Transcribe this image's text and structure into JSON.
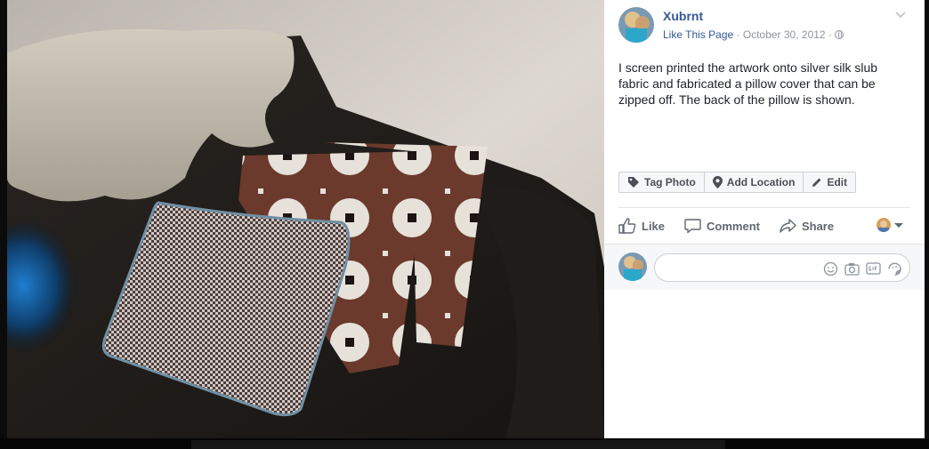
{
  "post": {
    "page_name": "Xubrnt",
    "like_page_label": "Like This Page",
    "separator": "·",
    "date": "October 30, 2012",
    "caption": "I screen printed the artwork onto silver silk slub fabric and fabricated a pillow cover that can be zipped off. The back of the pillow is shown."
  },
  "photo_actions": {
    "tag_photo": "Tag Photo",
    "add_location": "Add Location",
    "edit": "Edit"
  },
  "reactions": {
    "like": "Like",
    "comment": "Comment",
    "share": "Share"
  },
  "comment_composer": {
    "placeholder": "",
    "icons": [
      "emoji-icon",
      "camera-icon",
      "gif-icon",
      "sticker-icon"
    ]
  },
  "colors": {
    "link": "#365899",
    "muted": "#90949c",
    "text": "#1d2129",
    "button_text": "#4b4f56"
  }
}
